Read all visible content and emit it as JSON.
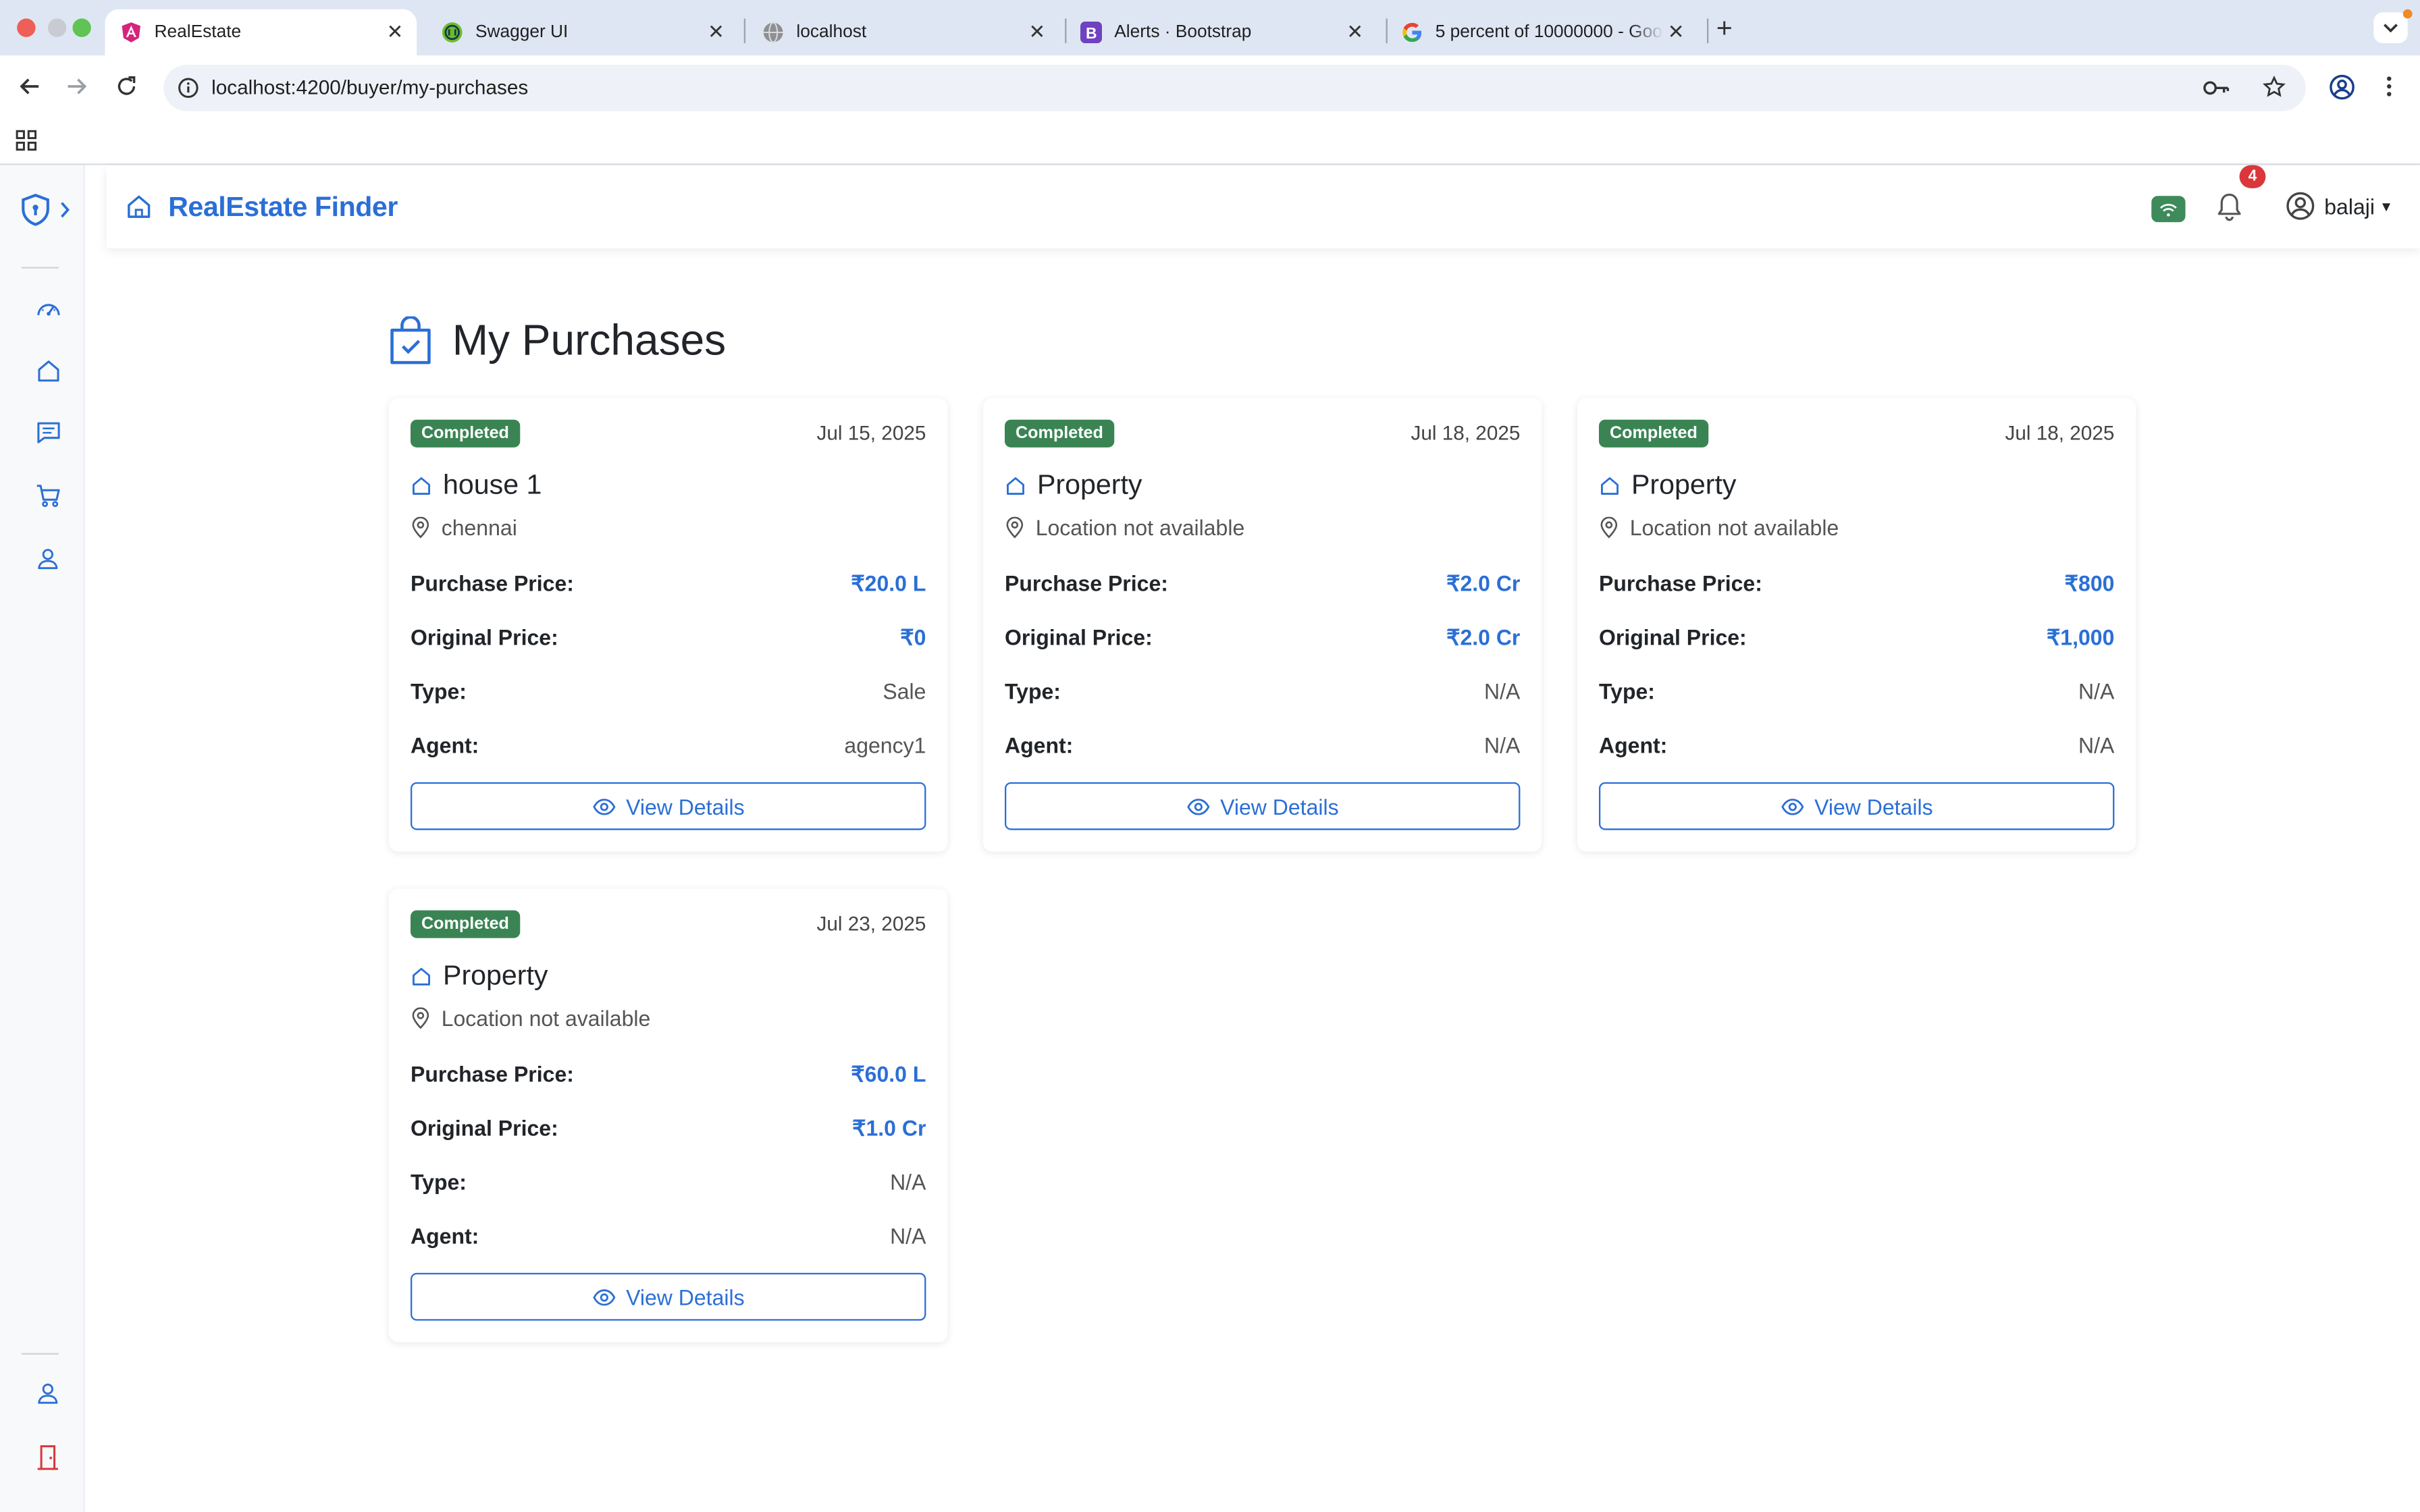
{
  "browser": {
    "tabs": [
      {
        "title": "RealEstate",
        "active": true,
        "icon": "angular-icon"
      },
      {
        "title": "Swagger UI",
        "active": false,
        "icon": "swagger-icon"
      },
      {
        "title": "localhost",
        "active": false,
        "icon": "globe-icon"
      },
      {
        "title": "Alerts · Bootstrap",
        "active": false,
        "icon": "bootstrap-icon"
      },
      {
        "title": "5 percent of 10000000 - Goo",
        "active": false,
        "icon": "google-icon"
      }
    ],
    "url": "localhost:4200/buyer/my-purchases"
  },
  "app": {
    "brand": "RealEstate Finder",
    "notification_count": "4",
    "username": "balaji",
    "page_title": "My Purchases",
    "colors": {
      "accent": "#2b6fd6",
      "status_completed": "#3a8454",
      "badge_red": "#d9373b"
    }
  },
  "labels": {
    "purchase_price": "Purchase Price:",
    "original_price": "Original Price:",
    "type": "Type:",
    "agent": "Agent:",
    "view_details": "View Details"
  },
  "purchases": [
    {
      "status": "Completed",
      "date": "Jul 15, 2025",
      "title": "house 1",
      "location": "chennai",
      "purchase_price": "₹20.0 L",
      "original_price": "₹0",
      "type": "Sale",
      "agent": "agency1"
    },
    {
      "status": "Completed",
      "date": "Jul 18, 2025",
      "title": "Property",
      "location": "Location not available",
      "purchase_price": "₹2.0 Cr",
      "original_price": "₹2.0 Cr",
      "type": "N/A",
      "agent": "N/A"
    },
    {
      "status": "Completed",
      "date": "Jul 18, 2025",
      "title": "Property",
      "location": "Location not available",
      "purchase_price": "₹800",
      "original_price": "₹1,000",
      "type": "N/A",
      "agent": "N/A"
    },
    {
      "status": "Completed",
      "date": "Jul 23, 2025",
      "title": "Property",
      "location": "Location not available",
      "purchase_price": "₹60.0 L",
      "original_price": "₹1.0 Cr",
      "type": "N/A",
      "agent": "N/A"
    }
  ]
}
